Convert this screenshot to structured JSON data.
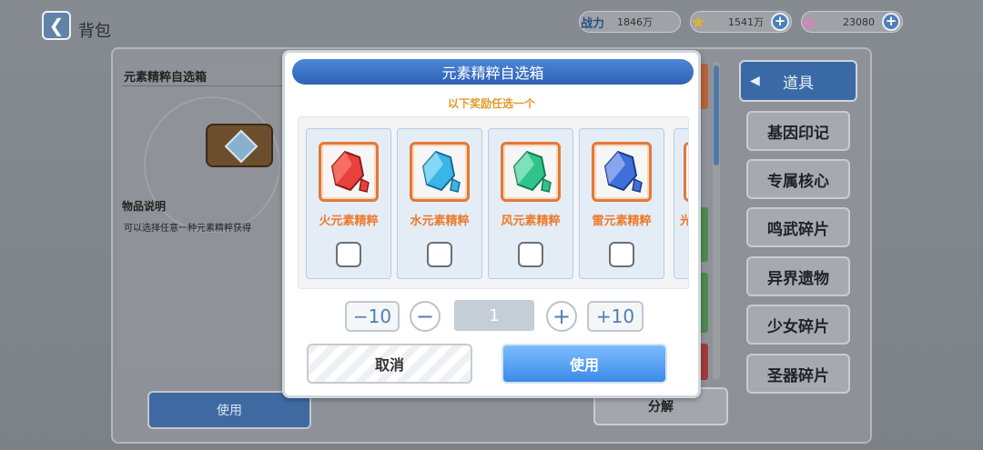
{
  "topbar": {
    "back_glyph": "❮",
    "title": "背包"
  },
  "resources": [
    {
      "icon": "战力",
      "value": "1846万"
    },
    {
      "icon": "★",
      "value": "1541万"
    },
    {
      "icon": "◆",
      "value": "23080"
    }
  ],
  "detail": {
    "title": "元素精粹自选箱",
    "section": "物品说明",
    "description": "可以选择任意一种元素精粹获得"
  },
  "background_buttons": {
    "use": "使用",
    "decompose": "分解"
  },
  "categories": {
    "header": "道具",
    "items": [
      "基因印记",
      "专属核心",
      "鸣武碎片",
      "异界遗物",
      "少女碎片",
      "圣器碎片"
    ]
  },
  "modal": {
    "title": "元素精粹自选箱",
    "subtitle": "以下奖励任选一个",
    "rewards": [
      {
        "name": "火元素精粹",
        "color": "#e8413b"
      },
      {
        "name": "水元素精粹",
        "color": "#38b6e6"
      },
      {
        "name": "风元素精粹",
        "color": "#2fc48a"
      },
      {
        "name": "雷元素精粹",
        "color": "#3f6fd8"
      }
    ],
    "partial_reward_text": "光",
    "quantity": {
      "minus10": "−10",
      "minus": "−",
      "value": "1",
      "plus": "+",
      "plus10": "+10"
    },
    "cancel": "取消",
    "use": "使用"
  }
}
